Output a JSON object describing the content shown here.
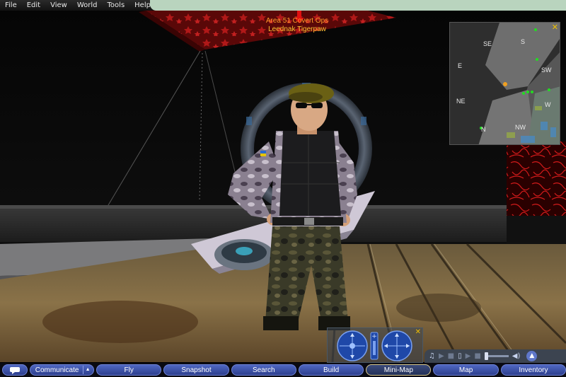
{
  "menu": {
    "items": [
      "File",
      "Edit",
      "View",
      "World",
      "Tools",
      "Help"
    ]
  },
  "avatar": {
    "group_title": "Area 51 Covert Ops",
    "name": "Leednak Tigerpaw",
    "group_title_color": "#ff9c2a",
    "name_color": "#ffc233"
  },
  "minimap": {
    "directions": [
      "SE",
      "S",
      "E",
      "SW",
      "NE",
      "W",
      "N",
      "NW"
    ],
    "close_icon": "close-icon",
    "close_color": "#f0c000"
  },
  "movement": {
    "icons": [
      "rotate-joystick-icon",
      "zoom-slider-icon",
      "pan-joystick-icon"
    ],
    "close_icon": "close-icon"
  },
  "media": {
    "icons": [
      "music-icon",
      "play-icon",
      "stop-icon",
      "media-icon",
      "play-icon",
      "stop-icon",
      "volume-icon",
      "expand-up-icon"
    ]
  },
  "toolbar": {
    "chat_icon": "chat-bubble-icon",
    "communicate": "Communicate",
    "communicate_arrow_icon": "chevron-up-icon",
    "buttons": [
      "Fly",
      "Snapshot",
      "Search",
      "Build",
      "Mini-Map",
      "Map",
      "Inventory"
    ],
    "active": "Mini-Map"
  }
}
